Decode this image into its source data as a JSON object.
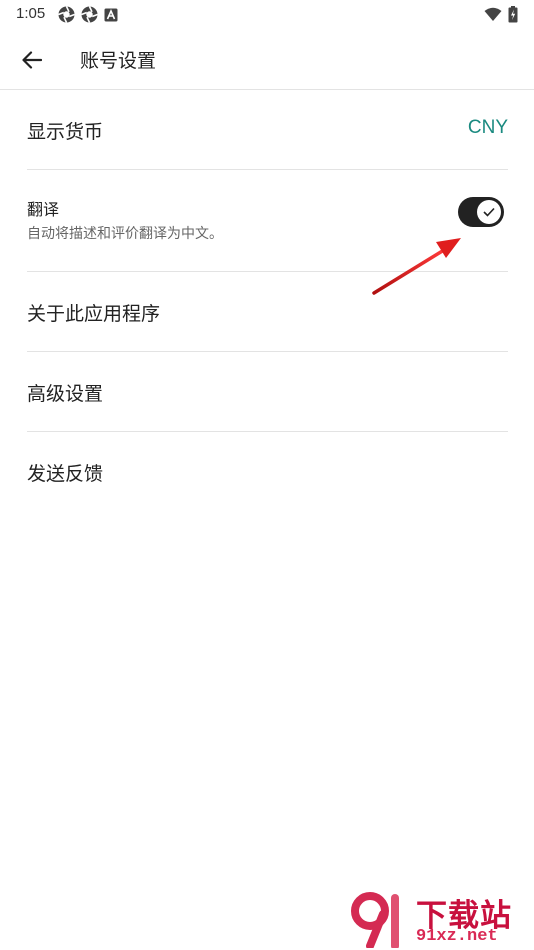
{
  "status_bar": {
    "time": "1:05",
    "left_icons": [
      "aperture-icon",
      "aperture-icon",
      "font-a-icon"
    ],
    "right_icons": [
      "wifi-icon",
      "battery-charging-icon"
    ]
  },
  "app_bar": {
    "title": "账号设置",
    "back_icon": "arrow-left-icon"
  },
  "settings": {
    "currency": {
      "label": "显示货币",
      "value": "CNY"
    },
    "translate": {
      "title": "翻译",
      "description": "自动将描述和评价翻译为中文。",
      "enabled": true
    },
    "about": {
      "label": "关于此应用程序"
    },
    "advanced": {
      "label": "高级设置"
    },
    "feedback": {
      "label": "发送反馈"
    }
  },
  "watermark": {
    "title": "下载站",
    "site": "91xz.net"
  },
  "colors": {
    "accent": "#1a8a80",
    "toggle_on": "#222222",
    "annotation": "#e01e1e",
    "watermark": "#c8103e"
  }
}
